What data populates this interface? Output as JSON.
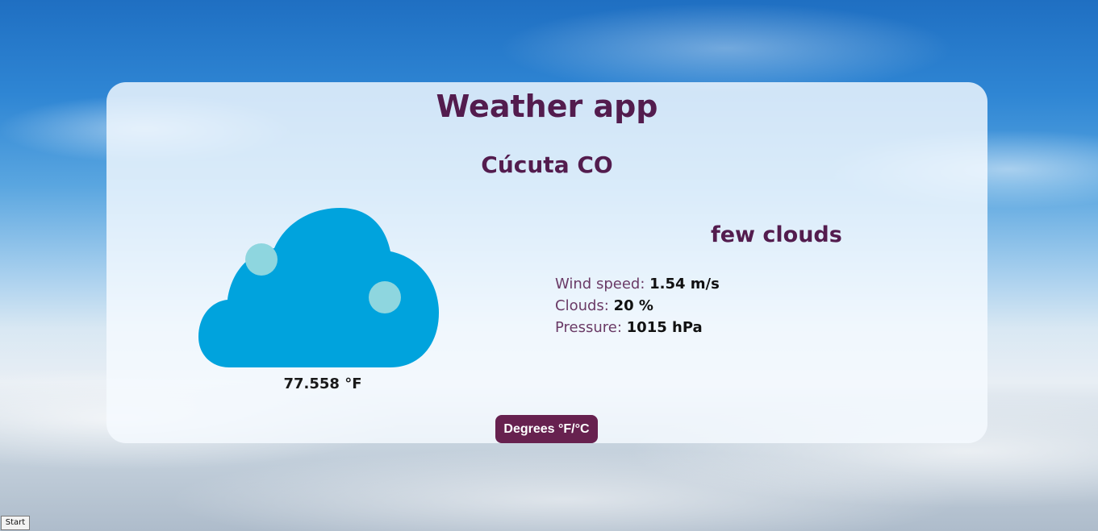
{
  "app": {
    "title": "Weather app"
  },
  "location": {
    "city": "Cúcuta CO"
  },
  "weather": {
    "icon": "cloud-icon",
    "temperature": "77.558 °F",
    "description": "few clouds",
    "details": [
      {
        "label": "Wind speed: ",
        "value": "1.54 m/s"
      },
      {
        "label": "Clouds: ",
        "value": "20 %"
      },
      {
        "label": "Pressure: ",
        "value": "1015 hPa"
      }
    ]
  },
  "controls": {
    "units_button": "Degrees °F/°C",
    "start_button": "Start"
  },
  "colors": {
    "heading": "#531c4e",
    "button": "#67214f",
    "cloud": "#00a3dd",
    "cloud_dots": "#8ed6df"
  }
}
